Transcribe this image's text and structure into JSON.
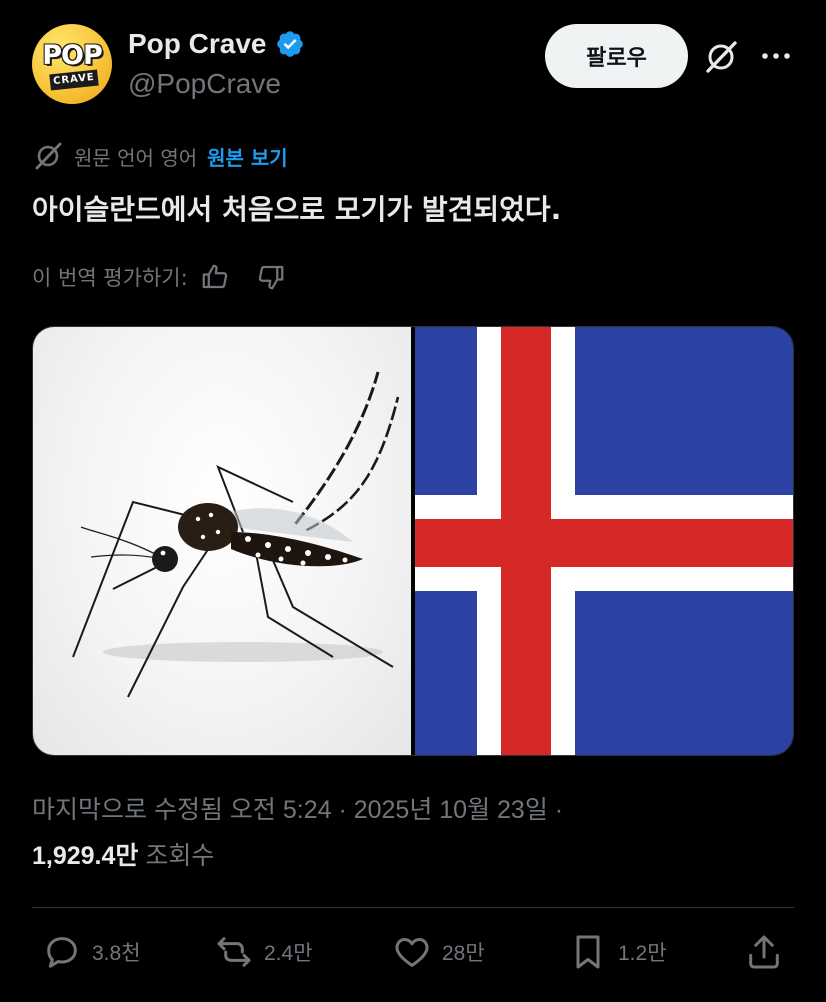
{
  "author": {
    "name": "Pop Crave",
    "handle": "@PopCrave",
    "avatar_text_top": "POP",
    "avatar_text_bottom": "CRAVE",
    "verified": true
  },
  "header": {
    "follow_label": "팔로우",
    "grok_icon": "grok-icon",
    "more_icon": "more-icon"
  },
  "translation": {
    "source_note": "원문 언어 영어",
    "view_original": "원본 보기"
  },
  "tweet": {
    "text": "아이슬란드에서 처음으로 모기가 발견되었다."
  },
  "rating": {
    "label": "이 번역 평가하기:"
  },
  "media": {
    "left_image": "mosquito-photo",
    "right_image": "iceland-flag",
    "flag_colors": {
      "blue": "#2b41a3",
      "white": "#ffffff",
      "red": "#d72828"
    }
  },
  "meta": {
    "edited_timestamp": "마지막으로 수정됨 오전 5:24 · 2025년 10월 23일 ·",
    "views_count": "1,929.4만",
    "views_label": "조회수"
  },
  "actions": {
    "replies": "3.8천",
    "reposts": "2.4만",
    "likes": "28만",
    "bookmarks": "1.2만"
  },
  "colors": {
    "background": "#000000",
    "text_primary": "#e7e9ea",
    "text_muted": "#71767b",
    "link": "#1d9bf0",
    "verified": "#1d9bf0",
    "follow_bg": "#eff3f4"
  }
}
